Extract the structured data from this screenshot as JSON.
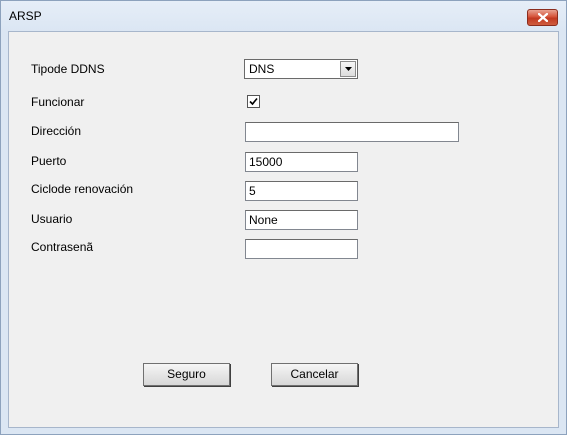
{
  "window": {
    "title": "ARSP"
  },
  "form": {
    "ddns_type_label": "Tipode DDNS",
    "ddns_type_value": "DNS",
    "enable_label": "Funcionar",
    "enable_checked": true,
    "address_label": "Dirección",
    "address_value": "",
    "port_label": "Puerto",
    "port_value": "15000",
    "renewal_label": "Ciclode renovación",
    "renewal_value": "5",
    "user_label": "Usuario",
    "user_value": "None",
    "password_label": "Contrasenã",
    "password_value": ""
  },
  "buttons": {
    "ok_label": "Seguro",
    "cancel_label": "Cancelar"
  },
  "icons": {
    "close": "close-icon",
    "dropdown": "chevron-down-icon",
    "check": "checkmark-icon"
  },
  "colors": {
    "close_button": "#c23a22",
    "dialog_background": "#f0f0f0",
    "frame": "#dbe6f3"
  }
}
